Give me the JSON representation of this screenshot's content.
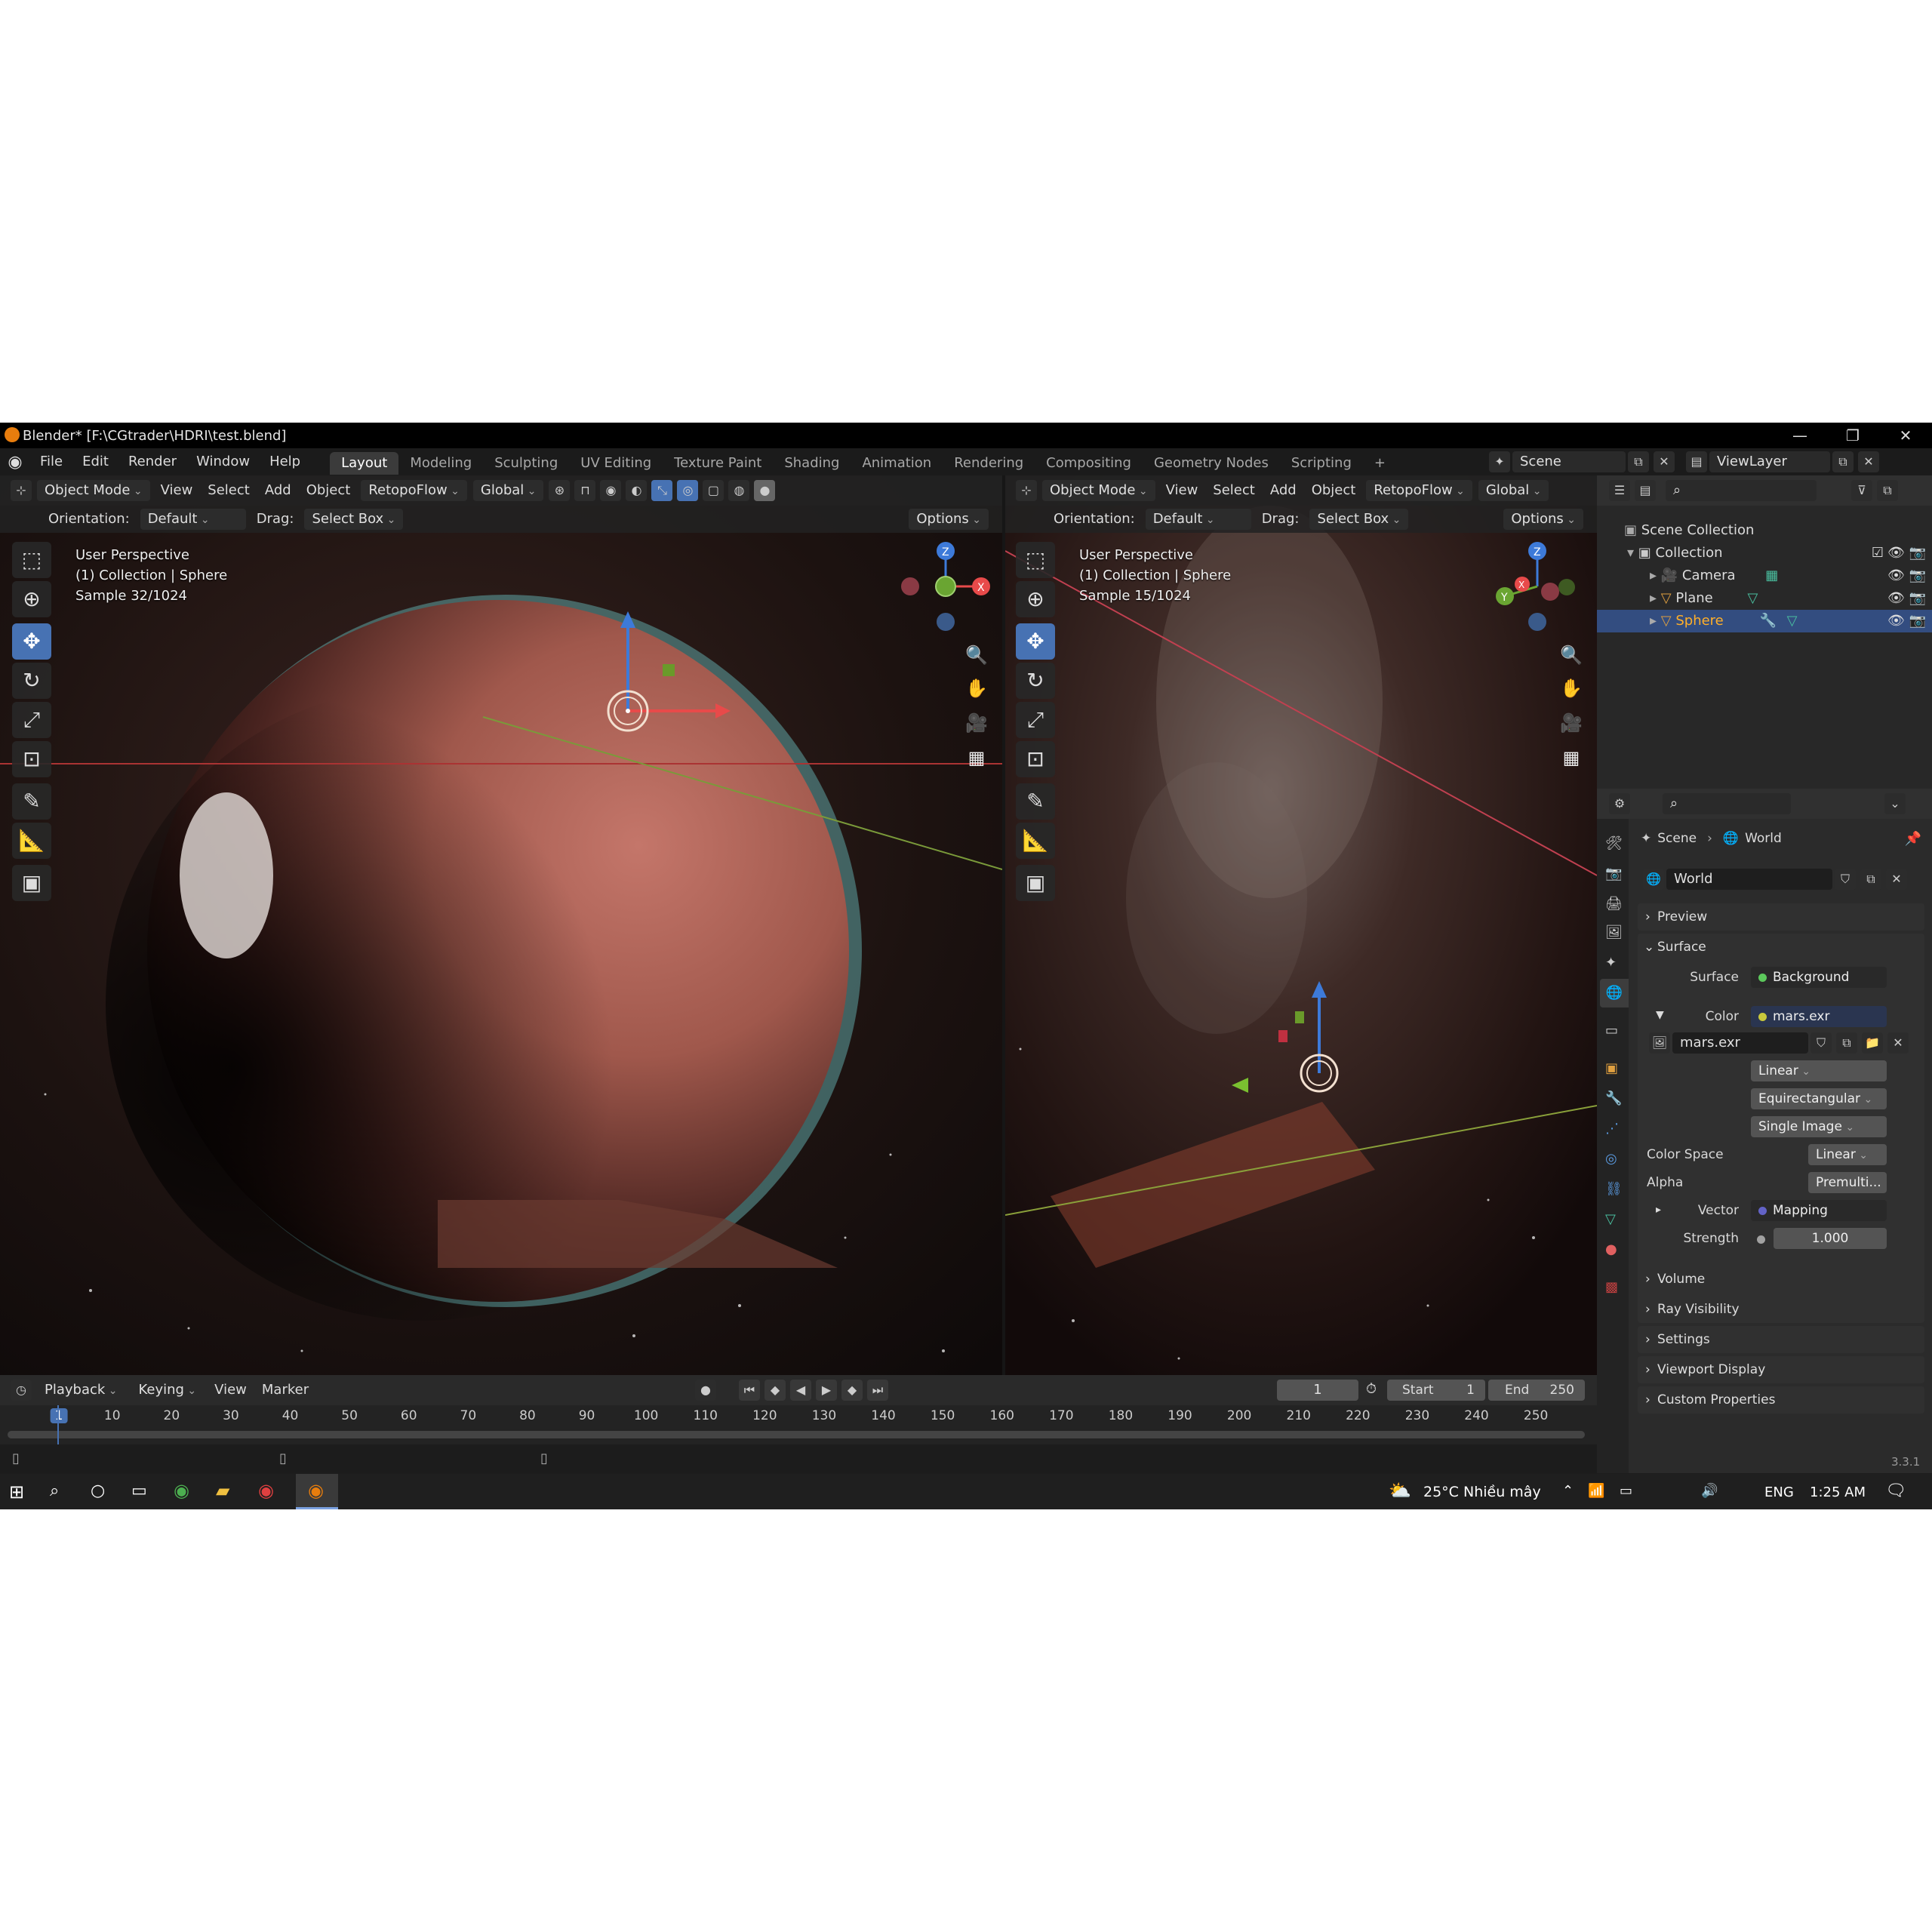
{
  "window": {
    "title": "Blender* [F:\\CGtrader\\HDRI\\test.blend]",
    "minimize": "—",
    "maximize": "❐",
    "close": "✕"
  },
  "menubar": {
    "menus": [
      "File",
      "Edit",
      "Render",
      "Window",
      "Help"
    ],
    "workspaces": [
      "Layout",
      "Modeling",
      "Sculpting",
      "UV Editing",
      "Texture Paint",
      "Shading",
      "Animation",
      "Rendering",
      "Compositing",
      "Geometry Nodes",
      "Scripting"
    ],
    "add_tab": "+",
    "scene": "Scene",
    "view_layer": "ViewLayer"
  },
  "viewport_left": {
    "mode": "Object Mode",
    "menus": [
      "View",
      "Select",
      "Add",
      "Object"
    ],
    "addon": "RetopoFlow",
    "orientation_space": "Global",
    "orientation_label": "Orientation:",
    "orientation_value": "Default",
    "drag_label": "Drag:",
    "drag_value": "Select Box",
    "options": "Options",
    "overlay_lines": [
      "User Perspective",
      "(1) Collection | Sphere",
      "Sample 32/1024"
    ]
  },
  "viewport_right": {
    "mode": "Object Mode",
    "menus": [
      "View",
      "Select",
      "Add",
      "Object"
    ],
    "addon": "RetopoFlow",
    "orientation_space": "Global",
    "orientation_label": "Orientation:",
    "orientation_value": "Default",
    "drag_label": "Drag:",
    "drag_value": "Select Box",
    "options": "Options",
    "overlay_lines": [
      "User Perspective",
      "(1) Collection | Sphere",
      "Sample 15/1024"
    ]
  },
  "outliner": {
    "root": "Scene Collection",
    "collection": "Collection",
    "items": [
      {
        "name": "Camera",
        "icon": "camera-icon"
      },
      {
        "name": "Plane",
        "icon": "mesh-icon"
      },
      {
        "name": "Sphere",
        "icon": "mesh-icon",
        "selected": true
      }
    ]
  },
  "properties": {
    "breadcrumb_scene": "Scene",
    "breadcrumb_world": "World",
    "world_name": "World",
    "panels": {
      "preview": "Preview",
      "surface": "Surface",
      "volume": "Volume",
      "ray_visibility": "Ray Visibility",
      "settings": "Settings",
      "viewport_display": "Viewport Display",
      "custom_properties": "Custom Properties"
    },
    "surface_label": "Surface",
    "surface_value": "Background",
    "color_label": "Color",
    "color_value": "mars.exr",
    "image_name": "mars.exr",
    "interpolation": "Linear",
    "projection": "Equirectangular",
    "source": "Single Image",
    "color_space_label": "Color Space",
    "color_space_value": "Linear",
    "alpha_label": "Alpha",
    "alpha_value": "Premulti...",
    "vector_label": "Vector",
    "vector_value": "Mapping",
    "strength_label": "Strength",
    "strength_value": "1.000"
  },
  "timeline": {
    "menus": [
      "Playback",
      "Keying",
      "View",
      "Marker"
    ],
    "current_frame": "1",
    "start_label": "Start",
    "start_value": "1",
    "end_label": "End",
    "end_value": "250",
    "ticks": [
      "1",
      "10",
      "20",
      "30",
      "40",
      "50",
      "60",
      "70",
      "80",
      "90",
      "100",
      "110",
      "120",
      "130",
      "140",
      "150",
      "160",
      "170",
      "180",
      "190",
      "200",
      "210",
      "220",
      "230",
      "240",
      "250"
    ],
    "version": "3.3.1"
  },
  "taskbar": {
    "weather": "25°C  Nhiều mây",
    "language": "ENG",
    "time": "1:25 AM"
  },
  "colors": {
    "accent": "#4772b3",
    "selected_row": "#334d80",
    "header": "#303030"
  }
}
